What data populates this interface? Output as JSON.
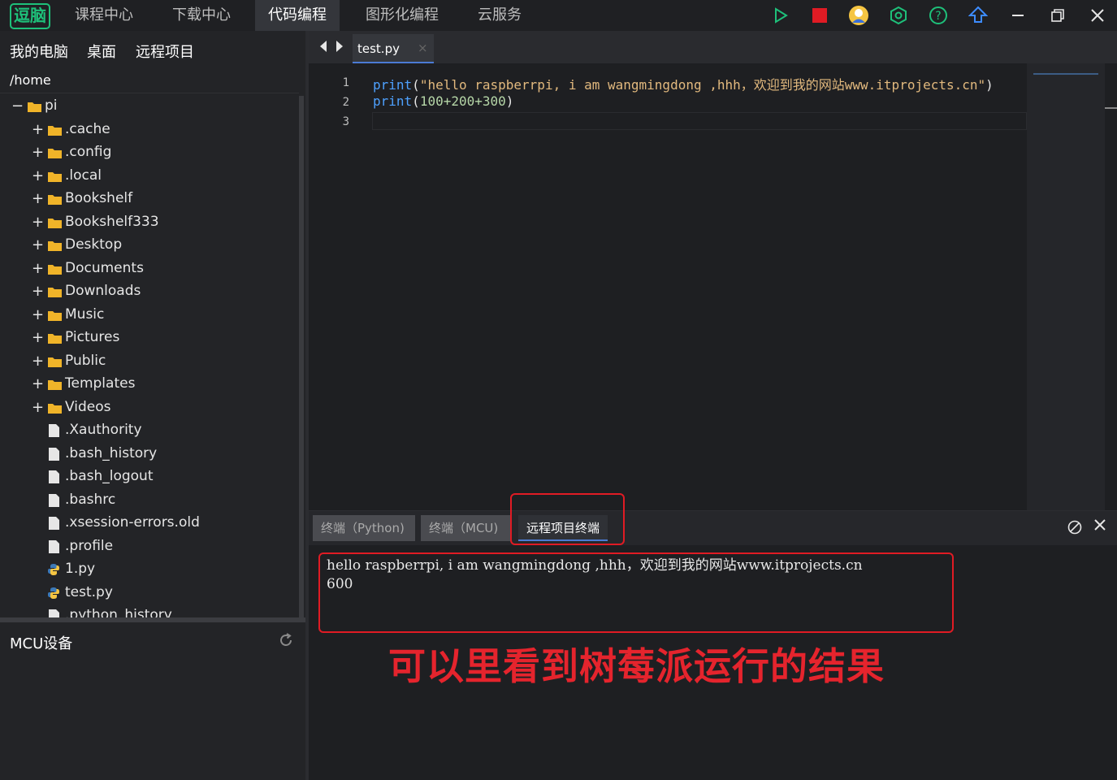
{
  "app": {
    "logo": "逗脑",
    "nav": [
      "课程中心",
      "下载中心",
      "代码编程",
      "图形化编程",
      "云服务"
    ],
    "active_nav": "代码编程"
  },
  "colors": {
    "accent": "#4b7bd5",
    "run": "#1ec07a",
    "stop": "#e01b24",
    "annotation": "#e5242d"
  },
  "toolbar_icons": [
    "run-icon",
    "stop-icon",
    "user-avatar-icon",
    "settings-hex-icon",
    "help-icon",
    "upload-icon",
    "minimize-icon",
    "restore-icon",
    "close-icon"
  ],
  "sidebar": {
    "tabs": [
      "我的电脑",
      "桌面",
      "远程项目"
    ],
    "path": "/home",
    "root": "pi",
    "folders": [
      ".cache",
      ".config",
      ".local",
      "Bookshelf",
      "Bookshelf333",
      "Desktop",
      "Documents",
      "Downloads",
      "Music",
      "Pictures",
      "Public",
      "Templates",
      "Videos"
    ],
    "files": [
      ".Xauthority",
      ".bash_history",
      ".bash_logout",
      ".bashrc",
      ".xsession-errors.old",
      ".profile"
    ],
    "py_files": [
      "1.py",
      "test.py"
    ],
    "partial_file": ".python_history",
    "mcu_title": "MCU设备"
  },
  "editor": {
    "tab": "test.py",
    "line_numbers": [
      "1",
      "2",
      "3"
    ],
    "line1": {
      "fn": "print",
      "open": "(",
      "text": "\"hello raspberrpi, i am wangmingdong ,hhh，欢迎到我的网站www.itprojects.cn\"",
      "close": ")"
    },
    "line2": {
      "fn": "print",
      "open": "(",
      "expr": "100+200+300",
      "close": ")"
    }
  },
  "panel": {
    "tabs": [
      "终端（Python)",
      "终端（MCU)",
      "远程项目终端"
    ],
    "active_tab": "远程项目终端",
    "output": "hello raspberrpi, i am wangmingdong ,hhh，欢迎到我的网站www.itprojects.cn\n600"
  },
  "annotation": "可以里看到树莓派运行的结果"
}
